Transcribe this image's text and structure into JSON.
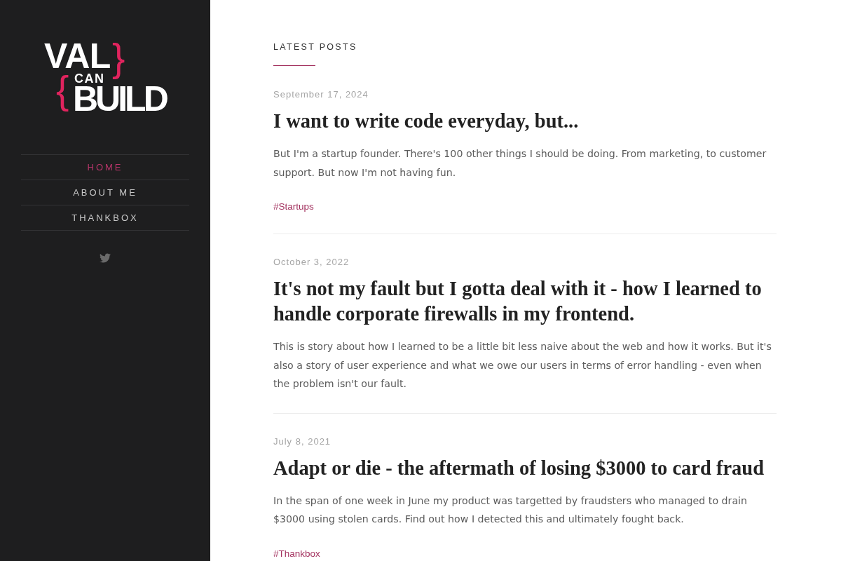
{
  "sidebar": {
    "logo": {
      "line_1": "VAL",
      "close_brace": "}",
      "line_2": "CAN",
      "open_brace": "{",
      "line_3": "BUILD"
    },
    "nav": [
      {
        "label": "HOME",
        "selected": true
      },
      {
        "label": "ABOUT ME",
        "selected": false
      },
      {
        "label": "THANKBOX",
        "selected": false
      }
    ]
  },
  "main": {
    "heading": "LATEST POSTS",
    "posts": [
      {
        "date": "September 17, 2024",
        "title": "I want to write code everyday, but...",
        "excerpt": "But I'm a startup founder. There's 100 other things I should be doing. From marketing, to customer support. But now I'm not having fun.",
        "tags": [
          "#Startups"
        ]
      },
      {
        "date": "October 3, 2022",
        "title": "It's not my fault but I gotta deal with it - how I learned to handle corporate firewalls in my frontend.",
        "excerpt": "This is story about how I learned to be a little bit less naive about the web and how it works. But it's also a story of user experience and what we owe our users in terms of error handling - even when the problem isn't our fault."
      },
      {
        "date": "July 8, 2021",
        "title": "Adapt or die - the aftermath of losing $3000 to card fraud",
        "excerpt": "In the span of one week in June my product was targetted by fraudsters who managed to drain $3000 using stolen cards. Find out how I detected this and ultimately fought back.",
        "tags": [
          "#Thankbox"
        ]
      }
    ]
  }
}
